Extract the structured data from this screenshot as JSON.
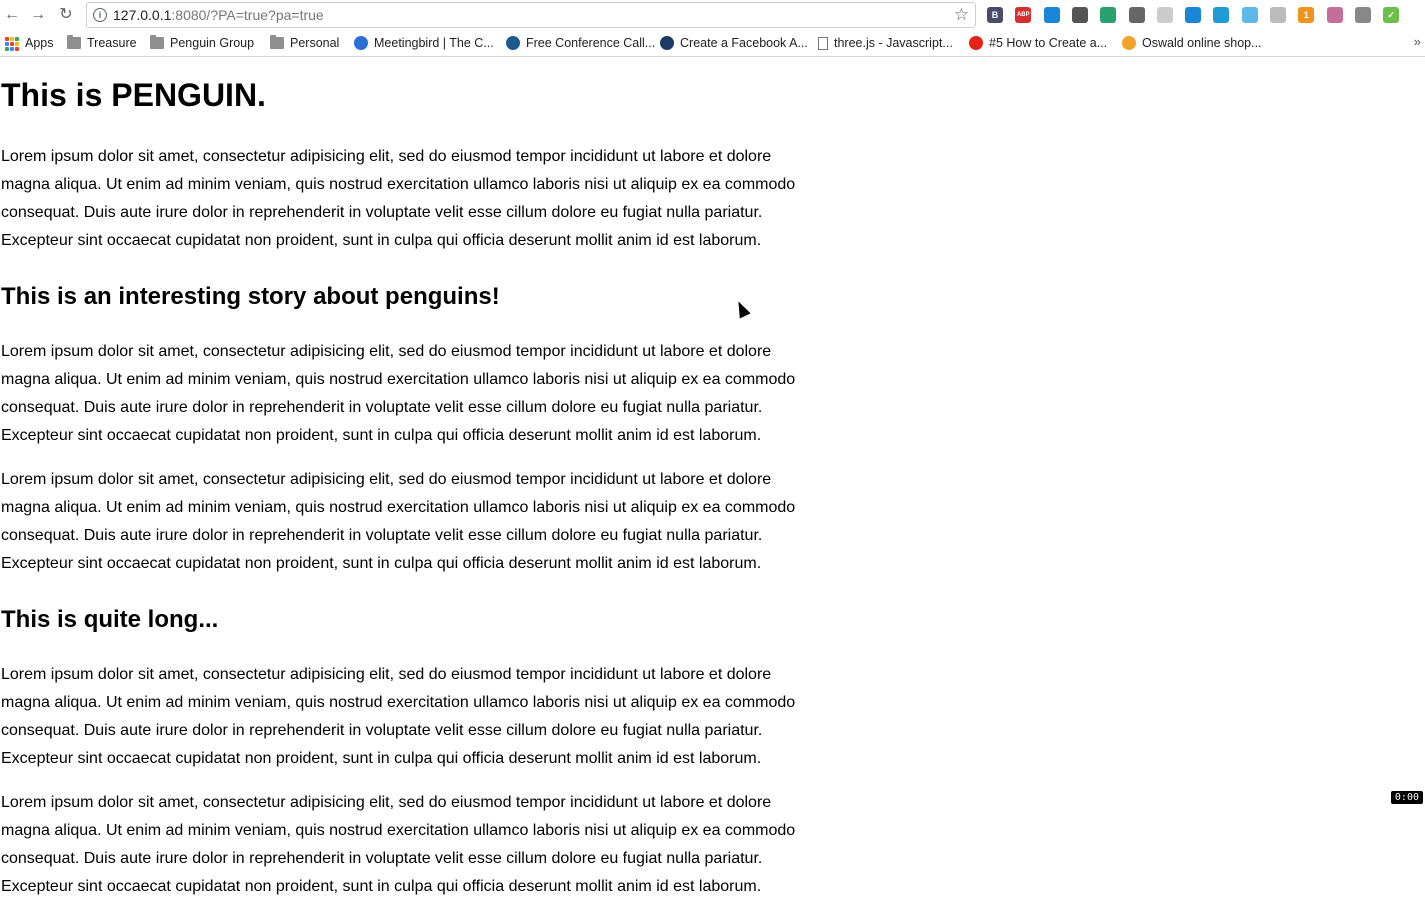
{
  "browser": {
    "url_host": "127.0.0.1",
    "url_rest": ":8080/?PA=true?pa=true",
    "bookmarks": [
      {
        "label": "Apps",
        "icon": "apps-grid-icon"
      },
      {
        "label": "Treasure",
        "icon": "folder-icon"
      },
      {
        "label": "Penguin Group",
        "icon": "folder-icon"
      },
      {
        "label": "Personal",
        "icon": "folder-icon"
      },
      {
        "label": "Meetingbird | The C...",
        "icon": "meetingbird-icon"
      },
      {
        "label": "Free Conference Call...",
        "icon": "freeconference-icon"
      },
      {
        "label": "Create a Facebook A...",
        "icon": "facebook-ad-icon"
      },
      {
        "label": "three.js - Javascript...",
        "icon": "page-icon"
      },
      {
        "label": "#5 How to Create a...",
        "icon": "youtube-icon"
      },
      {
        "label": "Oswald online shop...",
        "icon": "oswald-icon"
      }
    ],
    "more_label": "»",
    "extensions": [
      {
        "name": "bootstrap-ext-icon",
        "color": "#4b4b6b",
        "glyph": "B"
      },
      {
        "name": "adblock-plus-icon",
        "color": "#d43030",
        "glyph": "ABP"
      },
      {
        "name": "trello-ext-icon",
        "color": "#1a87d6",
        "glyph": ""
      },
      {
        "name": "pocket-icon",
        "color": "#555555",
        "glyph": ""
      },
      {
        "name": "green-globe-icon",
        "color": "#2aa06f",
        "glyph": ""
      },
      {
        "name": "eyedropper-icon",
        "color": "#666666",
        "glyph": ""
      },
      {
        "name": "grey-circle-icon",
        "color": "#cccccc",
        "glyph": ""
      },
      {
        "name": "trello-board-icon",
        "color": "#1a87d6",
        "glyph": ""
      },
      {
        "name": "blue-card-icon",
        "color": "#1f9cd8",
        "glyph": ""
      },
      {
        "name": "doc-icon",
        "color": "#5fb8e8",
        "glyph": ""
      },
      {
        "name": "grey-doc-icon",
        "color": "#bbbbbb",
        "glyph": ""
      },
      {
        "name": "orange-badge-icon",
        "color": "#f0941e",
        "glyph": "1"
      },
      {
        "name": "unicorn-icon",
        "color": "#c46f9a",
        "glyph": ""
      },
      {
        "name": "grey-stack-icon",
        "color": "#888888",
        "glyph": ""
      },
      {
        "name": "green-check-icon",
        "color": "#6cc04a",
        "glyph": "✓"
      }
    ]
  },
  "page": {
    "title": "This is PENGUIN.",
    "lorem": "Lorem ipsum dolor sit amet, consectetur adipisicing elit, sed do eiusmod tempor incididunt ut labore et dolore magna aliqua. Ut enim ad minim veniam, quis nostrud exercitation ullamco laboris nisi ut aliquip ex ea commodo consequat. Duis aute irure dolor in reprehenderit in voluptate velit esse cillum dolore eu fugiat nulla pariatur. Excepteur sint occaecat cupidatat non proident, sunt in culpa qui officia deserunt mollit anim id est laborum.",
    "heading_2": "This is an interesting story about penguins!",
    "heading_3": "This is quite long..."
  },
  "overlay": {
    "timer": "0:00"
  }
}
